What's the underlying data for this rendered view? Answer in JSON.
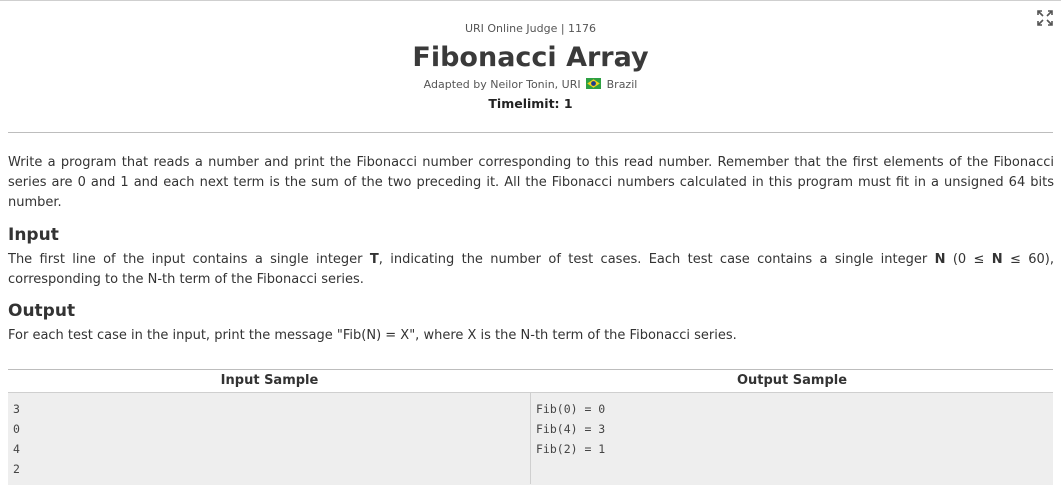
{
  "header": {
    "judge_line": "URI Online Judge | 1176",
    "title": "Fibonacci Array",
    "adapted_prefix": "Adapted by Neilor Tonin, URI",
    "country": "Brazil",
    "timelimit": "Timelimit: 1"
  },
  "icons": {
    "expand": "expand-icon",
    "flag": "brazil-flag-icon"
  },
  "colors": {
    "flag_green": "#2ea043",
    "flag_yellow": "#f2d21b",
    "flag_blue": "#1f3c8c",
    "sample_bg": "#eeeeee"
  },
  "description": "Write a program that reads a number and print the Fibonacci number corresponding to this read number. Remember that the first elements of the Fibonacci series are 0 and 1 and each next term is the sum of the two preceding it. All the Fibonacci numbers calculated in this program must fit in a unsigned 64 bits number.",
  "input": {
    "heading": "Input",
    "part1": "The first line of the input contains a single integer ",
    "var_t": "T",
    "part2": ", indicating the number of test cases. Each test case contains a single integer ",
    "var_n": "N",
    "part3": " (0 ≤ ",
    "var_n2": "N",
    "part4": " ≤ 60), corresponding to the N-th term of the Fibonacci series."
  },
  "output": {
    "heading": "Output",
    "text": "For each test case in the input, print the message \"Fib(N) = X\", where X is the N-th term of the Fibonacci series."
  },
  "samples": {
    "input_header": "Input Sample",
    "output_header": "Output Sample",
    "input_lines": [
      "3",
      "0",
      "4",
      "2"
    ],
    "output_lines": [
      "Fib(0) = 0",
      "Fib(4) = 3",
      "Fib(2) = 1"
    ]
  }
}
